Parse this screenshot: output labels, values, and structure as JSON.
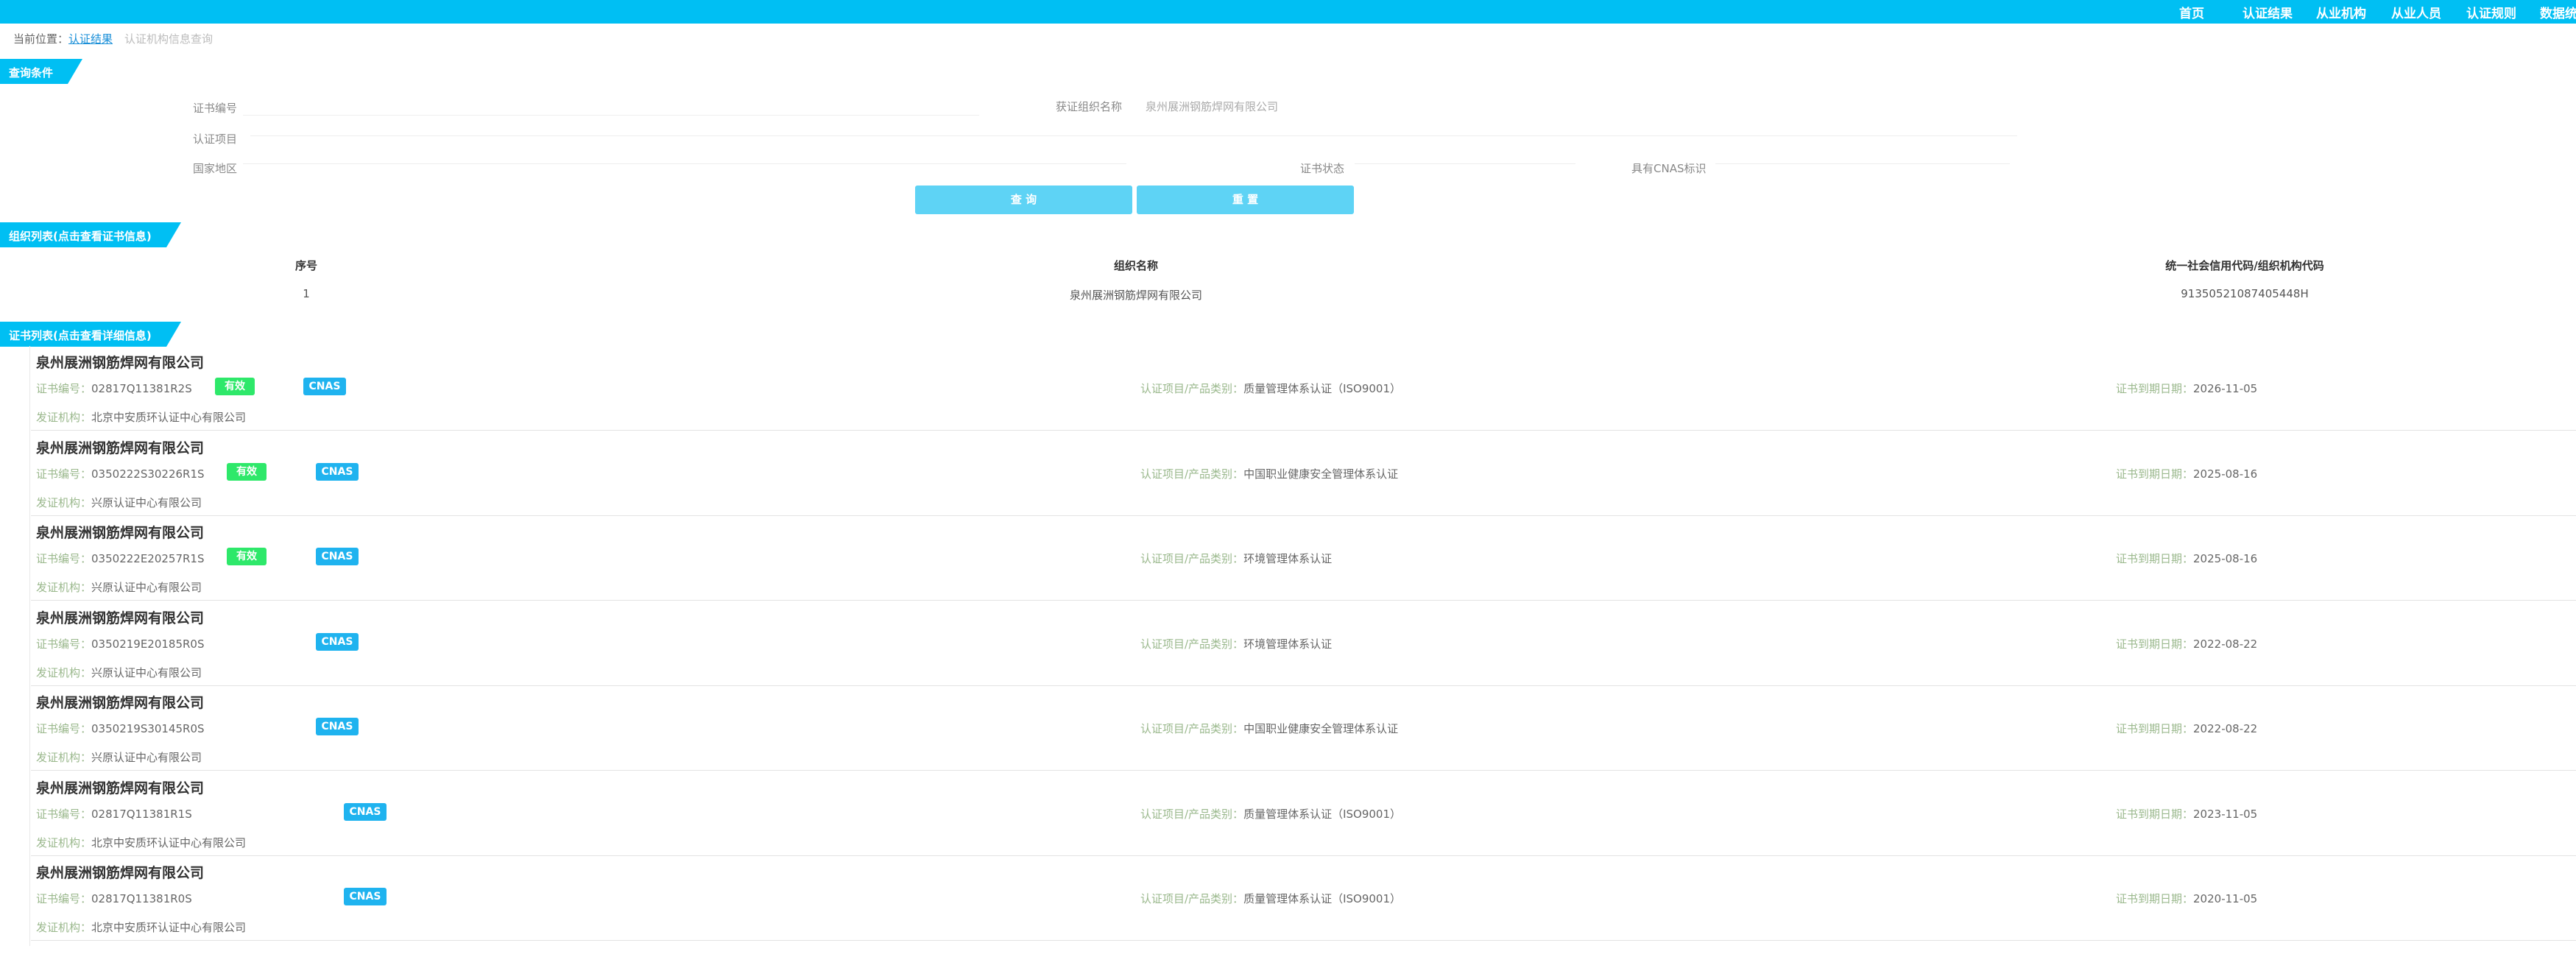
{
  "nav": [
    "首页",
    "认证结果",
    "从业机构",
    "从业人员",
    "认证规则",
    "数据统"
  ],
  "breadcrumb": {
    "prefix": "当前位置：",
    "link": "认证结果",
    "current": "认证机构信息查询"
  },
  "query": {
    "title": "查询条件",
    "cert_no_label": "证书编号",
    "org_label": "获证组织名称",
    "org_value": "泉州展洲钢筋焊网有限公司",
    "item_label": "认证项目",
    "region_label": "国家地区",
    "status_label": "证书状态",
    "cnas_label": "具有CNAS标识",
    "search_btn": "查 询",
    "reset_btn": "重 置"
  },
  "org_list": {
    "title": "组织列表(点击查看证书信息)",
    "headers": [
      "序号",
      "组织名称",
      "统一社会信用代码/组织机构代码"
    ],
    "rows": [
      {
        "no": "1",
        "name": "泉州展洲钢筋焊网有限公司",
        "code": "91350521087405448H"
      }
    ]
  },
  "cert_list": {
    "title": "证书列表(点击查看详细信息)",
    "labels": {
      "cert_no": "证书编号：",
      "category": "认证项目/产品类别：",
      "expiry": "证书到期日期：",
      "issuer": "发证机构："
    },
    "badges": {
      "valid": "有效",
      "cnas": "CNAS"
    },
    "items": [
      {
        "org": "泉州展洲钢筋焊网有限公司",
        "cert_no": "02817Q11381R2S",
        "category": "质量管理体系认证（ISO9001）",
        "expiry": "2026-11-05",
        "issuer": "北京中安质环认证中心有限公司",
        "valid": true
      },
      {
        "org": "泉州展洲钢筋焊网有限公司",
        "cert_no": "0350222S30226R1S",
        "category": "中国职业健康安全管理体系认证",
        "expiry": "2025-08-16",
        "issuer": "兴原认证中心有限公司",
        "valid": true
      },
      {
        "org": "泉州展洲钢筋焊网有限公司",
        "cert_no": "0350222E20257R1S",
        "category": "环境管理体系认证",
        "expiry": "2025-08-16",
        "issuer": "兴原认证中心有限公司",
        "valid": true
      },
      {
        "org": "泉州展洲钢筋焊网有限公司",
        "cert_no": "0350219E20185R0S",
        "category": "环境管理体系认证",
        "expiry": "2022-08-22",
        "issuer": "兴原认证中心有限公司",
        "valid": false
      },
      {
        "org": "泉州展洲钢筋焊网有限公司",
        "cert_no": "0350219S30145R0S",
        "category": "中国职业健康安全管理体系认证",
        "expiry": "2022-08-22",
        "issuer": "兴原认证中心有限公司",
        "valid": false
      },
      {
        "org": "泉州展洲钢筋焊网有限公司",
        "cert_no": "02817Q11381R1S",
        "category": "质量管理体系认证（ISO9001）",
        "expiry": "2023-11-05",
        "issuer": "北京中安质环认证中心有限公司",
        "valid": false
      },
      {
        "org": "泉州展洲钢筋焊网有限公司",
        "cert_no": "02817Q11381R0S",
        "category": "质量管理体系认证（ISO9001）",
        "expiry": "2020-11-05",
        "issuer": "北京中安质环认证中心有限公司",
        "valid": false
      }
    ]
  },
  "colors": {
    "topbar": "#00bff3",
    "section": "#00bff3",
    "button": "#5ed3f5",
    "valid_badge": "#2ee86a",
    "cnas_badge": "#1fb3ef"
  }
}
